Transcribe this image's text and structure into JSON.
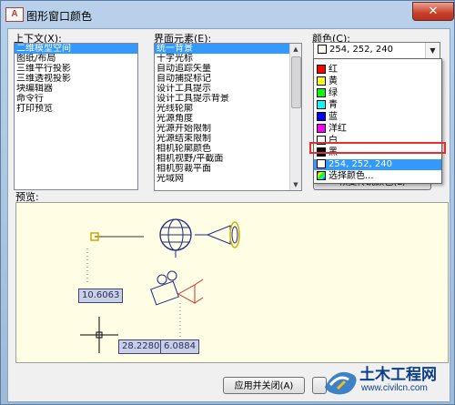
{
  "window": {
    "title": "图形窗口颜色",
    "app_icon_letter": "A",
    "close_glyph": "✕"
  },
  "context": {
    "label": "上下文(X):",
    "items": [
      "二维模型空间",
      "图纸/布局",
      "三维平行投影",
      "三维透视投影",
      "块编辑器",
      "命令行",
      "打印预览"
    ],
    "selected_index": 0
  },
  "elements": {
    "label": "界面元素(E):",
    "items": [
      "统一背景",
      "十字光标",
      "自动追踪矢量",
      "自动捕捉标记",
      "设计工具提示",
      "设计工具提示背景",
      "光线轮廓",
      "光源角度",
      "光源开始限制",
      "光源结束限制",
      "相机轮廓颜色",
      "相机视野/平截面",
      "相机剪裁平面",
      "光域网"
    ],
    "selected_index": 0
  },
  "color": {
    "label": "颜色(C):",
    "selected_value": "254, 252, 240",
    "selected_swatch": "#fefcf0",
    "options": [
      {
        "label": "红",
        "swatch": "#ff0000"
      },
      {
        "label": "黄",
        "swatch": "#ffff00"
      },
      {
        "label": "绿",
        "swatch": "#00ff00"
      },
      {
        "label": "青",
        "swatch": "#00ffff"
      },
      {
        "label": "蓝",
        "swatch": "#0000ff"
      },
      {
        "label": "洋红",
        "swatch": "#ff00ff"
      },
      {
        "label": "白",
        "swatch": "#ffffff"
      },
      {
        "label": "黑",
        "swatch": "#000000"
      },
      {
        "label": "254, 252, 240",
        "swatch": "#fefcf0"
      },
      {
        "label": "选择颜色...",
        "swatch": "picker"
      }
    ],
    "highlighted_option": "黑",
    "selected_option_index": 8
  },
  "restore_button": "恢复传统颜色(L)",
  "preview": {
    "label": "预览:",
    "values": [
      "10.6063",
      "28.2280",
      "6.0884"
    ]
  },
  "buttons": {
    "apply_close": "应用并关闭(A)"
  },
  "watermark": {
    "brand": "土木工程网",
    "url": "www.civilcn.com"
  }
}
